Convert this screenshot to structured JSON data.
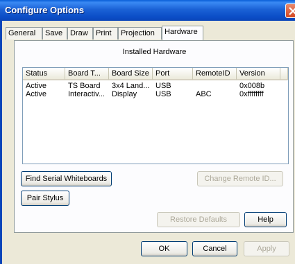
{
  "window": {
    "title": "Configure Options"
  },
  "tabs": [
    {
      "label": "General"
    },
    {
      "label": "Save"
    },
    {
      "label": "Draw"
    },
    {
      "label": "Print"
    },
    {
      "label": "Projection"
    },
    {
      "label": "Hardware",
      "active": true
    }
  ],
  "panel": {
    "title": "Installed Hardware"
  },
  "table": {
    "columns": [
      "Status",
      "Board T...",
      "Board Size",
      "Port",
      "RemoteID",
      "Version"
    ],
    "rows": [
      [
        "Active",
        "TS Board",
        "3x4 Land...",
        "USB",
        "",
        "0x008b"
      ],
      [
        "Active",
        "Interactiv...",
        "Display",
        "USB",
        "ABC",
        "0xffffffff"
      ]
    ]
  },
  "buttons": {
    "find_serial": "Find Serial Whiteboards",
    "change_remote": "Change Remote ID...",
    "pair_stylus": "Pair Stylus",
    "restore_defaults": "Restore Defaults",
    "help": "Help",
    "ok": "OK",
    "cancel": "Cancel",
    "apply": "Apply"
  }
}
